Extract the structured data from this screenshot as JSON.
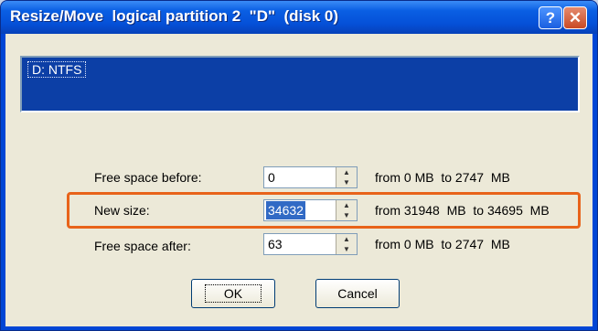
{
  "window": {
    "title": "Resize/Move  logical partition 2  \"D\"  (disk 0)",
    "help_label": "?",
    "close_label": "✕"
  },
  "partition_list": {
    "selected": "D: NTFS"
  },
  "fields": {
    "free_before": {
      "label": "Free space before:",
      "value": "0",
      "range": "from 0 MB  to 2747  MB"
    },
    "new_size": {
      "label": "New size:",
      "value": "34632",
      "range": "from 31948  MB  to 34695  MB"
    },
    "free_after": {
      "label": "Free space after:",
      "value": "63",
      "range": "from 0 MB  to 2747  MB"
    }
  },
  "buttons": {
    "ok": "OK",
    "cancel": "Cancel"
  },
  "colors": {
    "highlight": "#e8631a",
    "selection": "#316ac5",
    "titlebar": "#0550d8"
  }
}
